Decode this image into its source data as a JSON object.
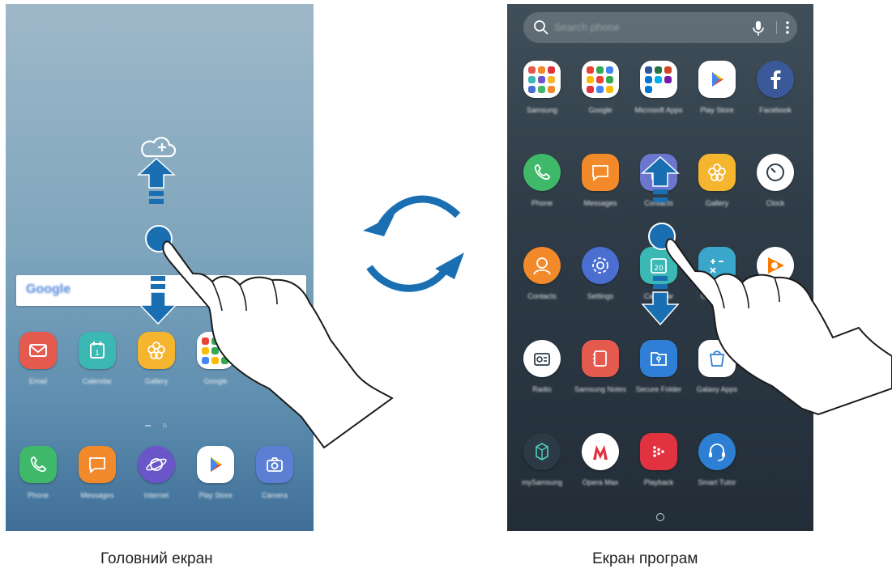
{
  "captions": {
    "home": "Головний екран",
    "apps": "Екран програм"
  },
  "home_screen": {
    "google_bar": {
      "logo": "Google"
    },
    "apps": [
      {
        "name": "Email",
        "icon": "email-icon",
        "color": "#e55a4f"
      },
      {
        "name": "Calendar",
        "icon": "calendar-icon",
        "color": "#3bb8b3",
        "day": "1"
      },
      {
        "name": "Gallery",
        "icon": "gallery-flower-icon",
        "color": "#f5b52e"
      },
      {
        "name": "Google",
        "icon": "google-folder-icon",
        "color": "#ffffff"
      }
    ],
    "dock": [
      {
        "name": "Phone",
        "icon": "phone-icon",
        "color": "#3fb86a"
      },
      {
        "name": "Messages",
        "icon": "messages-icon",
        "color": "#f28a2b"
      },
      {
        "name": "Internet",
        "icon": "internet-planet-icon",
        "color": "#6a56c9"
      },
      {
        "name": "Play Store",
        "icon": "play-store-icon",
        "color": "#ffffff"
      },
      {
        "name": "Camera",
        "icon": "camera-icon",
        "color": "#5b7fd3"
      }
    ]
  },
  "apps_screen": {
    "search": {
      "placeholder": "Search phone"
    },
    "rows": [
      [
        {
          "name": "Samsung",
          "icon": "samsung-folder-icon",
          "color": "#ffffff"
        },
        {
          "name": "Google",
          "icon": "google-folder-icon",
          "color": "#ffffff"
        },
        {
          "name": "Microsoft Apps",
          "icon": "microsoft-folder-icon",
          "color": "#ffffff"
        },
        {
          "name": "Play Store",
          "icon": "play-store-icon",
          "color": "#ffffff"
        },
        {
          "name": "Facebook",
          "icon": "facebook-icon",
          "color": "#3b5998"
        }
      ],
      [
        {
          "name": "Phone",
          "icon": "phone-icon",
          "color": "#3fb86a"
        },
        {
          "name": "Messages",
          "icon": "messages-icon",
          "color": "#f28a2b"
        },
        {
          "name": "Contacts",
          "icon": "contacts-icon",
          "color": "#6b76cf"
        },
        {
          "name": "Gallery",
          "icon": "gallery-flower-icon",
          "color": "#f5b52e"
        },
        {
          "name": "Clock",
          "icon": "clock-icon",
          "color": "#ffffff"
        }
      ],
      [
        {
          "name": "Contacts",
          "icon": "contacts-person-icon",
          "color": "#f28a2b"
        },
        {
          "name": "Settings",
          "icon": "settings-gear-icon",
          "color": "#4a6fd1"
        },
        {
          "name": "Calendar",
          "icon": "calendar-icon",
          "color": "#3bb8b3",
          "day": "20"
        },
        {
          "name": "Calculator",
          "icon": "calculator-icon",
          "color": "#3aa6c9"
        },
        {
          "name": "Play Music",
          "icon": "play-music-icon",
          "color": "#ffffff"
        }
      ],
      [
        {
          "name": "Radio",
          "icon": "radio-icon",
          "color": "#ffffff"
        },
        {
          "name": "Samsung Notes",
          "icon": "notes-icon",
          "color": "#e55a4f"
        },
        {
          "name": "Secure Folder",
          "icon": "secure-folder-icon",
          "color": "#2f7fd6"
        },
        {
          "name": "Galaxy Apps",
          "icon": "galaxy-apps-icon",
          "color": "#ffffff"
        }
      ],
      [
        {
          "name": "mySamsung",
          "icon": "mysamsung-icon",
          "color": "#2b3a44"
        },
        {
          "name": "Opera Max",
          "icon": "opera-max-icon",
          "color": "#ffffff"
        },
        {
          "name": "Playback",
          "icon": "playback-icon",
          "color": "#e0323f"
        },
        {
          "name": "Smart Tutor",
          "icon": "smart-tutor-headset-icon",
          "color": "#2c7fd3"
        }
      ]
    ]
  },
  "colors": {
    "accent_blue": "#1a6fb3",
    "gesture_outline": "#1b1b1b"
  }
}
